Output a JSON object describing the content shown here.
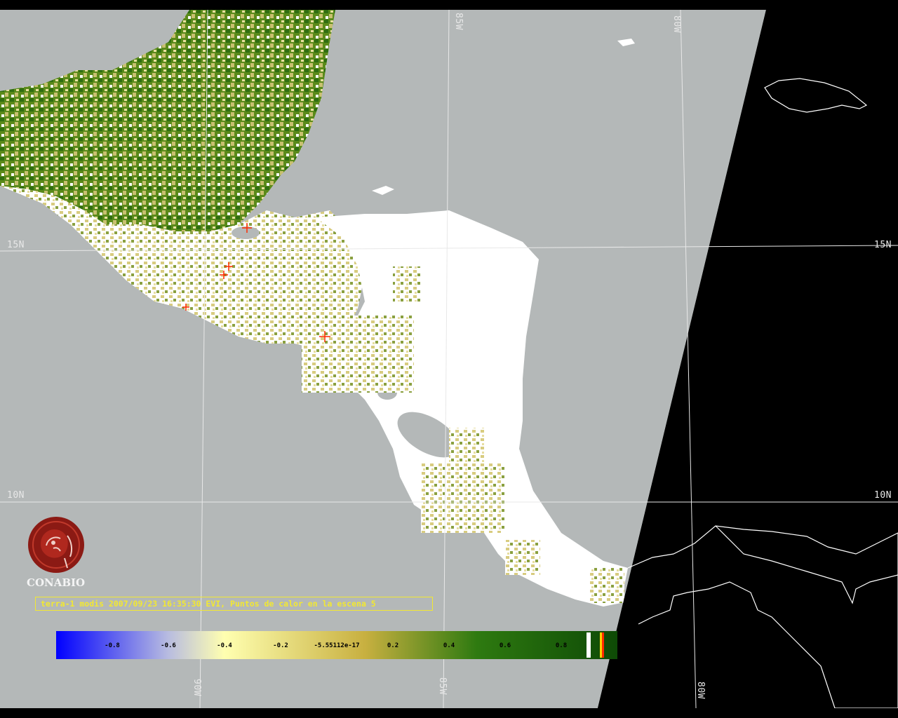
{
  "grid_labels": {
    "lon_85w_top": "85W",
    "lon_80w_top": "80W",
    "lon_90w_bottom": "90W",
    "lon_85w_bottom": "85W",
    "lon_80w_bottom": "80W",
    "lat_15n_left": "15N",
    "lat_15n_right": "15N",
    "lat_10n_left": "10N",
    "lat_10n_right": "10N"
  },
  "logo": {
    "text": "CONABIO"
  },
  "caption": "terra-1 modis 2007/09/23 16:35:30 EVI, Puntos de calor en la escena 5",
  "colorbar": {
    "ticks": [
      "-0.8",
      "-0.6",
      "-0.4",
      "-0.2",
      "-5.55112e-17",
      "0.2",
      "0.4",
      "0.6",
      "0.8"
    ],
    "stops": [
      "#0000ff",
      "#b8bce0",
      "#ffffb0",
      "#c8b040",
      "#2e7a10",
      "#0e4a06"
    ]
  },
  "colors": {
    "land_cloud": "#ffffff",
    "ocean": "#b4b8b8",
    "no_data": "#000000",
    "grid": "#e8e8e8",
    "caption": "#f2e832",
    "hotspot": "#ff2a00",
    "logo": "#8b1a14"
  }
}
